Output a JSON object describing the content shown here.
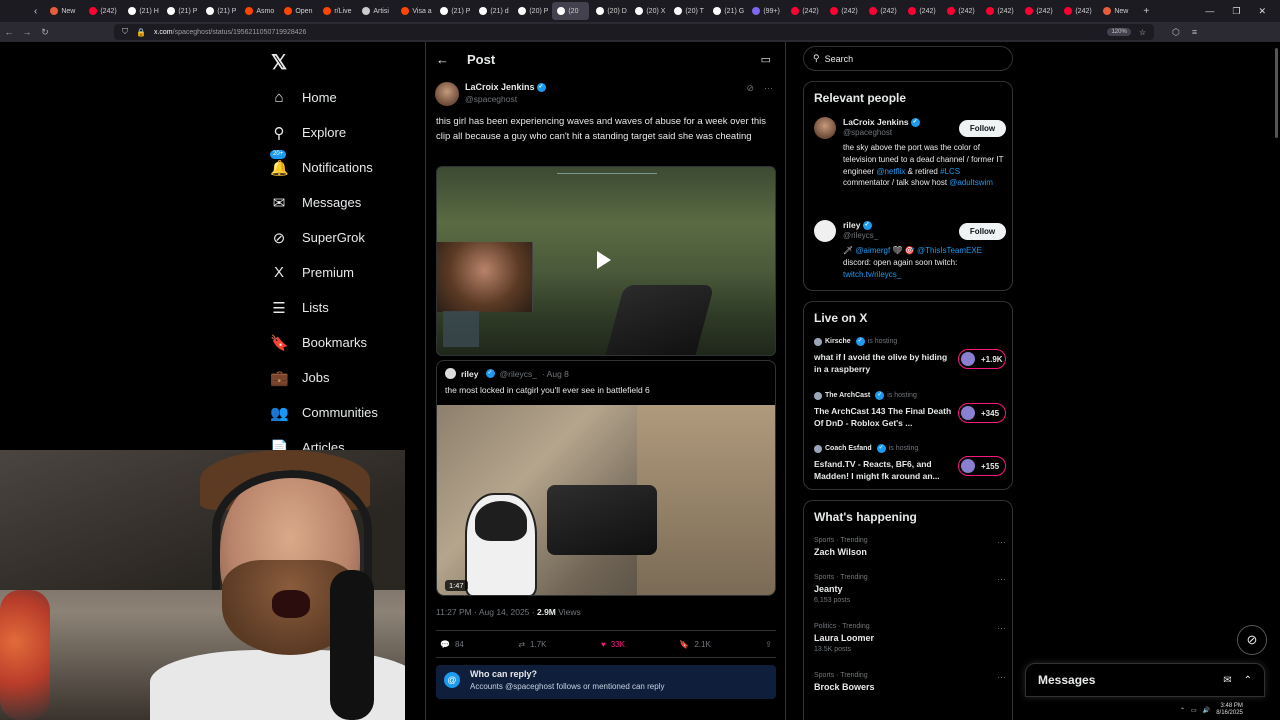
{
  "browser": {
    "tabs": [
      {
        "label": "New",
        "active": false,
        "color": "#e85d3a"
      },
      {
        "label": "(242)",
        "active": false,
        "color": "#ff0033"
      },
      {
        "label": "(21) H",
        "active": false,
        "color": "#ffffff"
      },
      {
        "label": "(21) P",
        "active": false,
        "color": "#ffffff"
      },
      {
        "label": "(21) P",
        "active": false,
        "color": "#ffffff"
      },
      {
        "label": "Asmo",
        "active": false,
        "color": "#ff4500"
      },
      {
        "label": "Open",
        "active": false,
        "color": "#ff4500"
      },
      {
        "label": "r/Live",
        "active": false,
        "color": "#ff4500"
      },
      {
        "label": "Artisi",
        "active": false,
        "color": "#cccccc"
      },
      {
        "label": "Visa a",
        "active": false,
        "color": "#ff4500"
      },
      {
        "label": "(21) P",
        "active": false,
        "color": "#ffffff"
      },
      {
        "label": "(21) d",
        "active": false,
        "color": "#ffffff"
      },
      {
        "label": "(20) P",
        "active": false,
        "color": "#ffffff"
      },
      {
        "label": "(20",
        "active": true,
        "color": "#ffffff"
      },
      {
        "label": "(20) D",
        "active": false,
        "color": "#ffffff"
      },
      {
        "label": "(20) X",
        "active": false,
        "color": "#ffffff"
      },
      {
        "label": "(20) T",
        "active": false,
        "color": "#ffffff"
      },
      {
        "label": "(21) G",
        "active": false,
        "color": "#ffffff"
      },
      {
        "label": "(99+)",
        "active": false,
        "color": "#7b68ee"
      },
      {
        "label": "(242)",
        "active": false,
        "color": "#ff0033"
      },
      {
        "label": "(242)",
        "active": false,
        "color": "#ff0033"
      },
      {
        "label": "(242)",
        "active": false,
        "color": "#ff0033"
      },
      {
        "label": "(242)",
        "active": false,
        "color": "#ff0033"
      },
      {
        "label": "(242)",
        "active": false,
        "color": "#ff0033"
      },
      {
        "label": "(242)",
        "active": false,
        "color": "#ff0033"
      },
      {
        "label": "(242)",
        "active": false,
        "color": "#ff0033"
      },
      {
        "label": "(242)",
        "active": false,
        "color": "#ff0033"
      },
      {
        "label": "New",
        "active": false,
        "color": "#e85d3a"
      }
    ],
    "url_domain": "x.com",
    "url_path": "/spaceghost/status/1956211050719928426",
    "zoom": "120%"
  },
  "leftnav": {
    "items": [
      {
        "label": "Home",
        "icon": "⌂",
        "name": "home"
      },
      {
        "label": "Explore",
        "icon": "⚲",
        "name": "explore"
      },
      {
        "label": "Notifications",
        "icon": "🔔",
        "name": "notifications"
      },
      {
        "label": "Messages",
        "icon": "✉",
        "name": "messages"
      },
      {
        "label": "SuperGrok",
        "icon": "⊘",
        "name": "supergrok"
      },
      {
        "label": "Premium",
        "icon": "X",
        "name": "premium"
      },
      {
        "label": "Lists",
        "icon": "☰",
        "name": "lists"
      },
      {
        "label": "Bookmarks",
        "icon": "🔖",
        "name": "bookmarks"
      },
      {
        "label": "Jobs",
        "icon": "💼",
        "name": "jobs"
      },
      {
        "label": "Communities",
        "icon": "👥",
        "name": "communities"
      },
      {
        "label": "Articles",
        "icon": "📄",
        "name": "articles"
      }
    ],
    "notif_badge": "20+"
  },
  "post": {
    "header_title": "Post",
    "author_name": "LaCroix Jenkins",
    "author_handle": "@spaceghost",
    "text": "this girl has been experiencing waves and waves of abuse for a week over this clip all because a guy who can't hit a standing target said she was cheating",
    "quote": {
      "name": "riley",
      "handle": "@rileycs_",
      "date": "· Aug 8",
      "text": "the most locked in catgirl you'll ever see in battlefield 6",
      "duration": "1:47"
    },
    "timestamp": "11:27 PM · Aug 14, 2025 ·",
    "views": "2.9M",
    "views_label": "Views",
    "replies": "84",
    "reposts": "1.7K",
    "likes": "33K",
    "bookmarks": "2.1K",
    "who_can_reply_title": "Who can reply?",
    "who_can_reply_text": "Accounts @spaceghost follows or mentioned can reply"
  },
  "right": {
    "search_placeholder": "Search",
    "relevant_title": "Relevant people",
    "people": [
      {
        "name": "LaCroix Jenkins",
        "handle": "@spaceghost",
        "bio": [
          "the sky above the port was the color of television tuned to a dead channel / former IT engineer ",
          "@netflix",
          " & retired ",
          "#LCS",
          " commentator / talk show host ",
          "@adultswim"
        ],
        "follow": "Follow"
      },
      {
        "name": "riley",
        "handle": "@rileycs_",
        "bio": [
          "🗡 ",
          "@aimergf",
          " ❤ 🎯 ",
          "@ThisIsTeamEXE",
          " discord: open again soon twitch: ",
          "twitch.tv/rileycs_"
        ],
        "follow": "Follow"
      }
    ],
    "live_title": "Live on X",
    "live": [
      {
        "host": "Kirsche",
        "hosting": "is hosting",
        "title": "what if I avoid the olive by hiding in a raspberry",
        "count": "+1.9K"
      },
      {
        "host": "The ArchCast",
        "hosting": "is hosting",
        "title": "The ArchCast 143 The Final Death Of DnD - Roblox Get's ...",
        "count": "+345"
      },
      {
        "host": "Coach Esfand",
        "hosting": "is hosting",
        "title": "Esfand.TV - Reacts, BF6, and Madden! I might fk around an...",
        "count": "+155"
      }
    ],
    "happening_title": "What's happening",
    "trends": [
      {
        "category": "Sports · Trending",
        "name": "Zach Wilson",
        "count": ""
      },
      {
        "category": "Sports · Trending",
        "name": "Jeanty",
        "count": "6,153 posts"
      },
      {
        "category": "Politics · Trending",
        "name": "Laura Loomer",
        "count": "13.5K posts"
      },
      {
        "category": "Sports · Trending",
        "name": "Brock Bowers",
        "count": ""
      }
    ]
  },
  "messages_drawer": {
    "label": "Messages"
  },
  "taskbar": {
    "time": "3:48 PM",
    "date": "8/16/2025"
  }
}
